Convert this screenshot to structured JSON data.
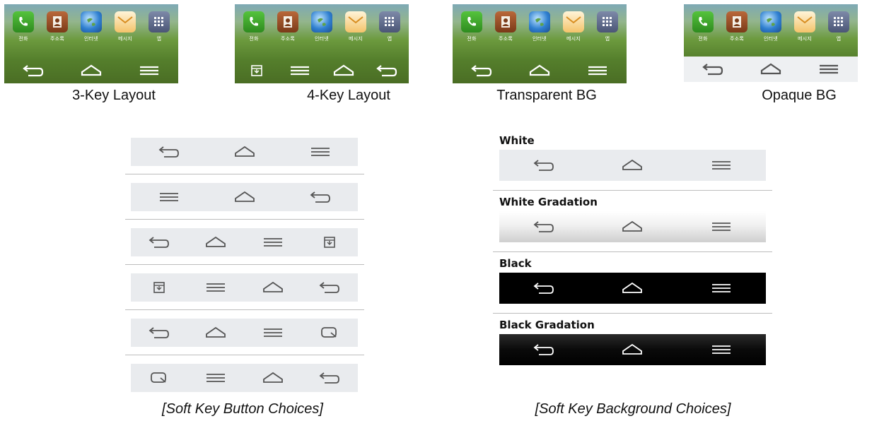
{
  "home_screens": [
    {
      "caption": "3-Key Layout",
      "bar": "transparent",
      "keys": [
        "back",
        "home",
        "menu"
      ]
    },
    {
      "caption": "4-Key Layout",
      "bar": "transparent",
      "keys": [
        "notification",
        "menu",
        "home",
        "back"
      ]
    },
    {
      "caption": "Transparent BG",
      "bar": "transparent",
      "keys": [
        "back",
        "home",
        "menu"
      ]
    },
    {
      "caption": "Opaque BG",
      "bar": "opaque",
      "keys": [
        "back",
        "home",
        "menu"
      ]
    }
  ],
  "dock_apps": [
    {
      "label": "전화",
      "icon": "phone-icon"
    },
    {
      "label": "주소록",
      "icon": "contacts-icon"
    },
    {
      "label": "인터넷",
      "icon": "internet-icon"
    },
    {
      "label": "메시지",
      "icon": "message-icon"
    },
    {
      "label": "앱",
      "icon": "apps-icon"
    }
  ],
  "button_choices": {
    "caption": "[Soft Key Button Choices]",
    "rows": [
      [
        "back",
        "home",
        "menu"
      ],
      [
        "menu",
        "home",
        "back"
      ],
      [
        "back",
        "home",
        "menu",
        "notification"
      ],
      [
        "notification",
        "menu",
        "home",
        "back"
      ],
      [
        "back",
        "home",
        "menu",
        "qslide"
      ],
      [
        "qslide",
        "menu",
        "home",
        "back"
      ]
    ]
  },
  "background_choices": {
    "caption": "[Soft Key Background Choices]",
    "options": [
      {
        "label": "White",
        "style": "white",
        "icon_color": "#555555"
      },
      {
        "label": "White Gradation",
        "style": "whitegrad",
        "icon_color": "#555555"
      },
      {
        "label": "Black",
        "style": "black",
        "icon_color": "#ffffff"
      },
      {
        "label": "Black Gradation",
        "style": "blackgrad",
        "icon_color": "#ffffff"
      }
    ]
  },
  "colors": {
    "key_icon_dark": "#555555",
    "key_icon_light": "#ffffff",
    "bar_light": "#e9ebee"
  }
}
